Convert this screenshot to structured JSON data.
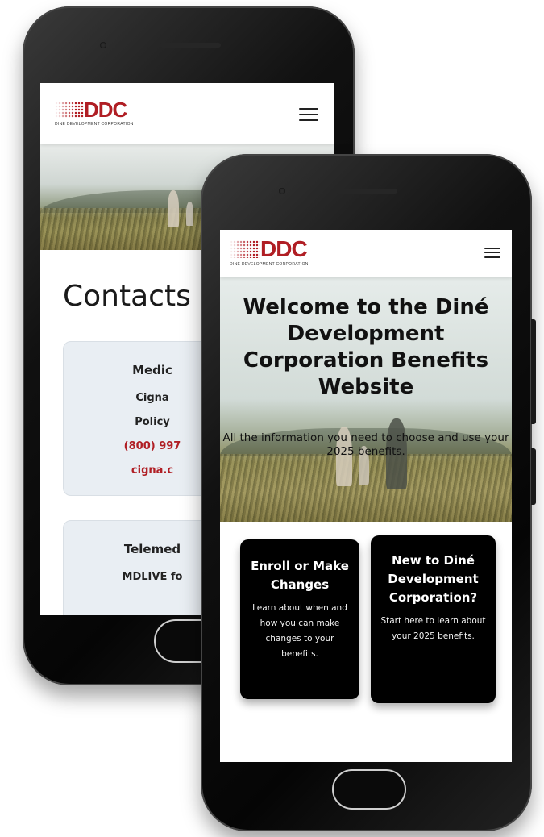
{
  "brand": {
    "logo_text": "DDC",
    "logo_subtitle": "DINÉ DEVELOPMENT CORPORATION",
    "accent_color": "#b01e24"
  },
  "back_phone": {
    "page_title": "Contacts",
    "cards": [
      {
        "heading": "Medic",
        "lines": [
          "Cigna",
          "Policy"
        ],
        "phone": "(800) 997",
        "link": "cigna.c"
      },
      {
        "heading": "Telemed",
        "lines": [
          "MDLIVE fo"
        ]
      }
    ]
  },
  "front_phone": {
    "hero_title": "Welcome to the Diné Development Corporation Benefits Website",
    "hero_subtitle": "All the information you need to choose and use your 2025 benefits.",
    "tiles": [
      {
        "title": "Enroll or Make Changes",
        "body": "Learn about when and how you can make changes to your benefits."
      },
      {
        "title": "New to Diné Development Corporation?",
        "body": "Start here to learn about your 2025 benefits."
      }
    ]
  },
  "icons": {
    "menu": "hamburger-menu-icon",
    "logo": "ddc-logo-icon"
  }
}
